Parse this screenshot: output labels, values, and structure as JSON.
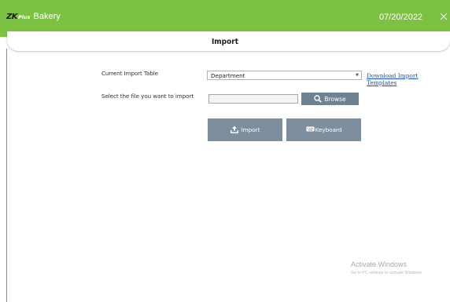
{
  "titlebar": {
    "logo_zk": "ZK",
    "logo_plus": "Plus",
    "app_name": "Bakery",
    "date": "07/20/2022",
    "colors": {
      "background": "#7dc142",
      "text": "#ffffff"
    },
    "close_icon": "close-icon"
  },
  "header": {
    "title": "Import"
  },
  "form": {
    "table_label": "Current Import Table",
    "table_value": "Department",
    "download_link": "Download Import Templates",
    "file_label": "Select the file you want to import",
    "file_value": "",
    "browse_label": "Browse",
    "browse_icon": "search-icon"
  },
  "actions": {
    "import_label": "Import",
    "import_icon": "upload-icon",
    "keyboard_label": "Keyboard",
    "keyboard_icon": "keyboard-icon",
    "button_color": "#7d8e9e"
  },
  "watermark": {
    "title": "Activate Windows",
    "subtitle": "Go to PC settings to activate Windows."
  },
  "link_color": "#1f52c8"
}
